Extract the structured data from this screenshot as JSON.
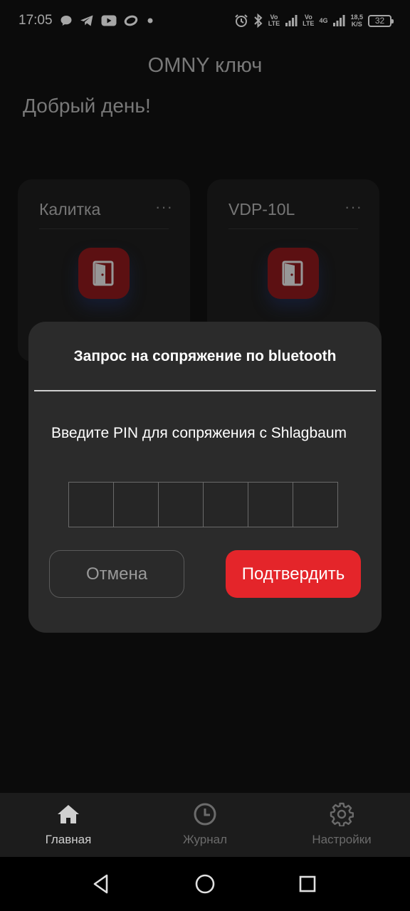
{
  "status_bar": {
    "time": "17:05",
    "left_icons": [
      "chat-bubble-icon",
      "telegram-icon",
      "youtube-icon",
      "ring-icon",
      "dot-icon"
    ],
    "sim1_label_top": "Vo",
    "sim1_label_bottom": "LTE",
    "sim2_label_top": "Vo",
    "sim2_label_bottom": "LTE",
    "network_type": "4G",
    "speed_value": "18,5",
    "speed_unit": "K/S",
    "battery": "32"
  },
  "app": {
    "title": "OMNY ключ",
    "greeting": "Добрый день!"
  },
  "cards": [
    {
      "title": "Калитка",
      "more": "···"
    },
    {
      "title": "VDP-10L",
      "more": "···"
    }
  ],
  "dialog": {
    "title": "Запрос на сопряжение по bluetooth",
    "message": "Введите PIN для сопряжения с Shlagbaum",
    "pin_length": 6,
    "cancel_label": "Отмена",
    "confirm_label": "Подтвердить"
  },
  "bottom_nav": {
    "items": [
      {
        "label": "Главная",
        "icon": "home-icon",
        "active": true
      },
      {
        "label": "Журнал",
        "icon": "clock-icon",
        "active": false
      },
      {
        "label": "Настройки",
        "icon": "gear-icon",
        "active": false
      }
    ]
  },
  "colors": {
    "accent": "#e4252a",
    "door_button": "#8e1a1d",
    "nav_active": "#d0d0d0",
    "nav_inactive": "#6b6b6b"
  }
}
